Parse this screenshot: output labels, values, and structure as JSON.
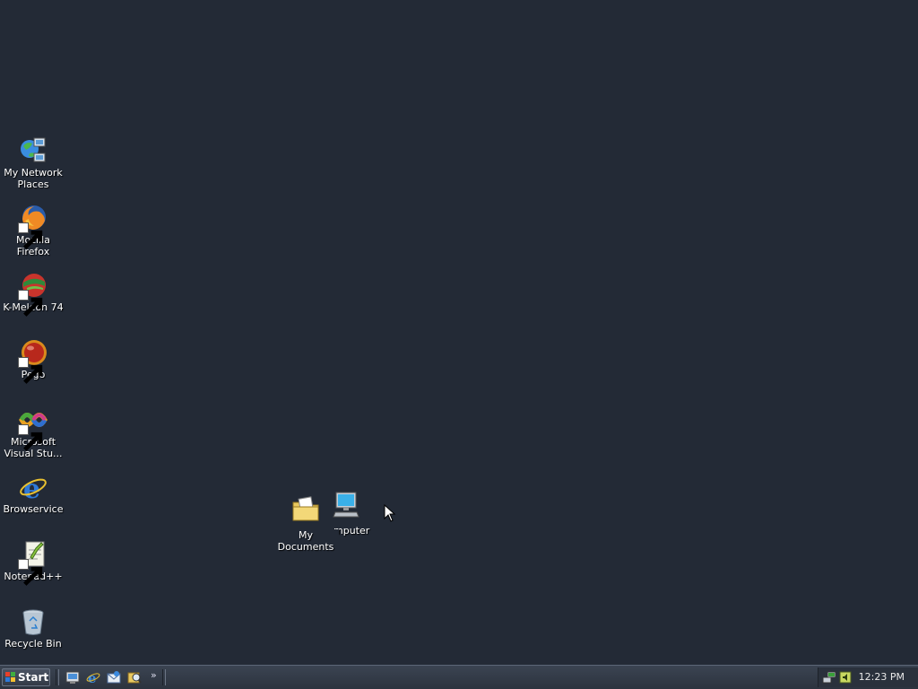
{
  "desktop": {
    "background_color": "#232a36",
    "icons": [
      {
        "label": "My Network\nPlaces",
        "icon": "network-places-icon"
      },
      {
        "label": "Mozilla Firefox",
        "icon": "firefox-icon"
      },
      {
        "label": "K-Meleon 74",
        "icon": "k-meleon-icon"
      },
      {
        "label": "Pego",
        "icon": "pego-icon"
      },
      {
        "label": "Microsoft\nVisual Stu...",
        "icon": "visual-studio-icon"
      },
      {
        "label": "Browservice",
        "icon": "internet-explorer-icon"
      },
      {
        "label": "Notepad++",
        "icon": "notepad-plus-plus-icon"
      },
      {
        "label": "Recycle Bin",
        "icon": "recycle-bin-icon"
      }
    ],
    "overlapping": {
      "my_documents": "My Documents",
      "my_computer_visible": "mputer"
    }
  },
  "taskbar": {
    "start_label": "Start",
    "quick_launch": [
      "show-desktop-icon",
      "internet-explorer-icon",
      "outlook-express-icon",
      "search-icon"
    ],
    "overflow": "»",
    "clock": "12:23 PM"
  }
}
